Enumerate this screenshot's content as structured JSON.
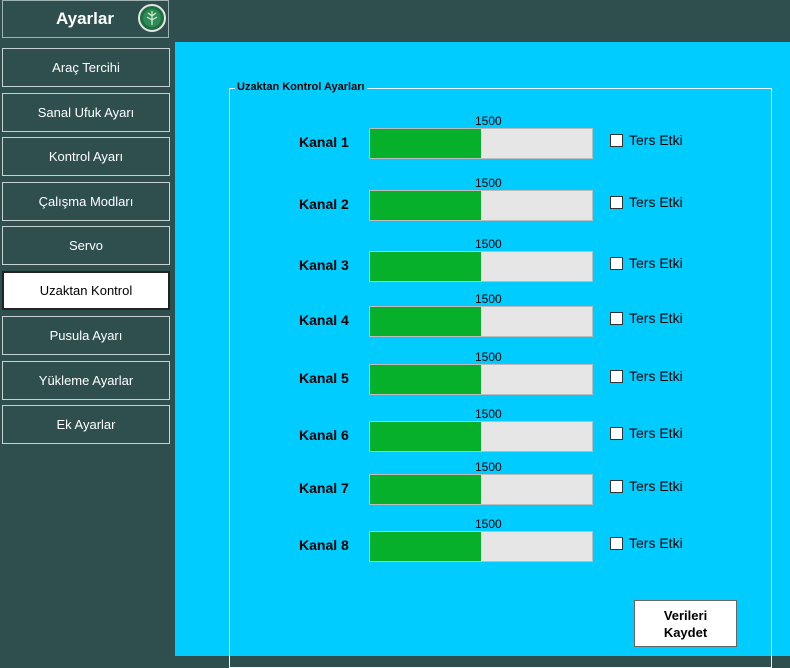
{
  "header": {
    "title": "Ayarlar",
    "icon": "tree-logo-icon"
  },
  "sidebar": {
    "items": [
      {
        "label": "Araç Tercihi"
      },
      {
        "label": "Sanal Ufuk Ayarı"
      },
      {
        "label": "Kontrol Ayarı"
      },
      {
        "label": "Çalışma Modları"
      },
      {
        "label": "Servo"
      },
      {
        "label": "Uzaktan Kontrol",
        "active": true
      },
      {
        "label": "Pusula Ayarı"
      },
      {
        "label": "Yükleme Ayarlar"
      },
      {
        "label": "Ek Ayarlar"
      }
    ]
  },
  "main": {
    "group_title": "Uzaktan Kontrol Ayarları",
    "channel_min": 1000,
    "channel_max": 2000,
    "channels": [
      {
        "label": "Kanal 1",
        "value": "1500",
        "reverse_label": "Ters Etki",
        "reverse_checked": false
      },
      {
        "label": "Kanal 2",
        "value": "1500",
        "reverse_label": "Ters Etki",
        "reverse_checked": false
      },
      {
        "label": "Kanal 3",
        "value": "1500",
        "reverse_label": "Ters Etki",
        "reverse_checked": false
      },
      {
        "label": "Kanal 4",
        "value": "1500",
        "reverse_label": "Ters Etki",
        "reverse_checked": false
      },
      {
        "label": "Kanal 5",
        "value": "1500",
        "reverse_label": "Ters Etki",
        "reverse_checked": false
      },
      {
        "label": "Kanal 6",
        "value": "1500",
        "reverse_label": "Ters Etki",
        "reverse_checked": false
      },
      {
        "label": "Kanal 7",
        "value": "1500",
        "reverse_label": "Ters Etki",
        "reverse_checked": false
      },
      {
        "label": "Kanal 8",
        "value": "1500",
        "reverse_label": "Ters Etki",
        "reverse_checked": false
      }
    ],
    "save_button": {
      "line1": "Verileri",
      "line2": "Kaydet"
    }
  },
  "colors": {
    "background": "#2f4f4f",
    "panel": "#00ccff",
    "bar_fill": "#06b02a",
    "bar_track": "#e6e6e6"
  }
}
